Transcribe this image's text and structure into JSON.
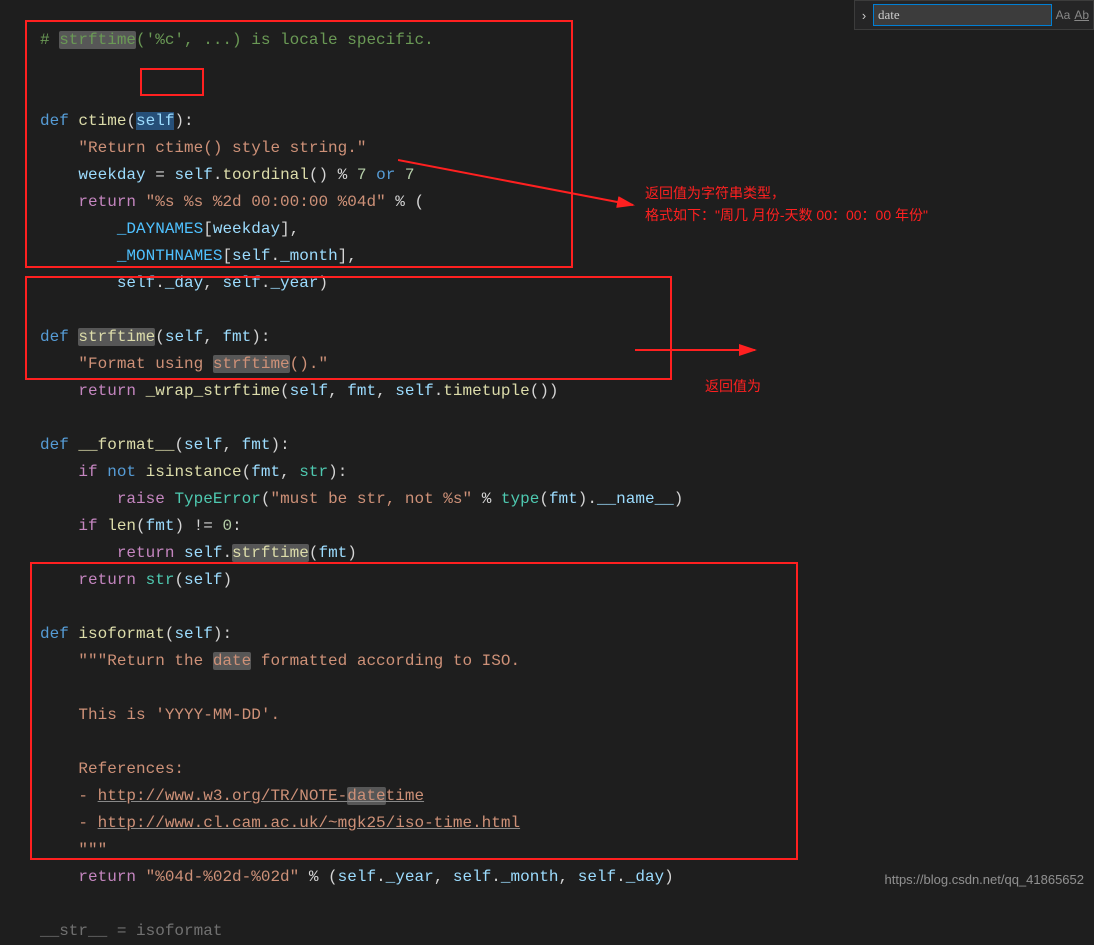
{
  "find": {
    "value": "date",
    "opt_case": "Aa",
    "opt_word": "Ab"
  },
  "code": {
    "line0_comment": "# ",
    "line0_hl": "strftime",
    "line0_rest": "('%c', ...) is locale specific.",
    "ctime": {
      "def": "def",
      "name": "ctime",
      "self": "self",
      "doc": "\"Return ctime() style string.\"",
      "weekday": "weekday",
      "eq": " = ",
      "selfcall": "self",
      "toordinal": "toordinal",
      "mod": " % ",
      "seven1": "7",
      "or": "or",
      "seven2": "7",
      "return": "return",
      "fmt": "\"%s %s %2d 00:00:00 %04d\"",
      "pct": " % (",
      "daynames": "_DAYNAMES",
      "br1": "[",
      "wk": "weekday",
      "br2": "],",
      "monthnames": "_MONTHNAMES",
      "selfmonth": "self",
      "month": "_month",
      "selfday": "self",
      "day": "_day",
      "selfyear": "self",
      "year": "_year"
    },
    "strftime": {
      "def": "def",
      "name": "strftime",
      "self": "self",
      "fmt": "fmt",
      "doc_pre": "\"Format using ",
      "doc_hl": "strftime",
      "doc_post": "().\"",
      "return": "return",
      "wrap": "_wrap_strftime",
      "fmtp": "fmt",
      "timetuple": "timetuple"
    },
    "format": {
      "def": "def",
      "name": "__format__",
      "self": "self",
      "fmt": "fmt",
      "if": "if",
      "not": "not",
      "isinstance": "isinstance",
      "str": "str",
      "raise": "raise",
      "TypeError": "TypeError",
      "msg": "\"must be str, not %s\"",
      "pct": " % ",
      "type": "type",
      "namedunder": "__name__",
      "len": "len",
      "zero": "0",
      "return": "return",
      "selfstrf": "self",
      "strfcall": "strftime",
      "strcall": "str"
    },
    "isoformat": {
      "def": "def",
      "name": "isoformat",
      "self": "self",
      "doc1_pre": "\"\"\"Return the ",
      "doc1_hl": "date",
      "doc1_post": " formatted according to ISO.",
      "doc2": "This is 'YYYY-MM-DD'.",
      "doc3": "References:",
      "doc4_pre": "- ",
      "doc4_url1": "http://www.w3.org/TR/NOTE-",
      "doc4_hl": "date",
      "doc4_url2": "time",
      "doc5_pre": "- ",
      "doc5_url": "http://www.cl.cam.ac.uk/~mgk25/iso-time.html",
      "doc6": "\"\"\"",
      "return": "return",
      "fmt": "\"%04d-%02d-%02d\"",
      "pct": " % (",
      "year": "_year",
      "month": "_month",
      "day": "_day"
    },
    "tail": "__str__ = isoformat"
  },
  "annotations": {
    "a1_line1": "返回值为字符串类型，",
    "a1_line2": "格式如下：\"周几 月份-天数 00：00：00 年份\"",
    "a2": "返回值为"
  },
  "watermark": "https://blog.csdn.net/qq_41865652"
}
